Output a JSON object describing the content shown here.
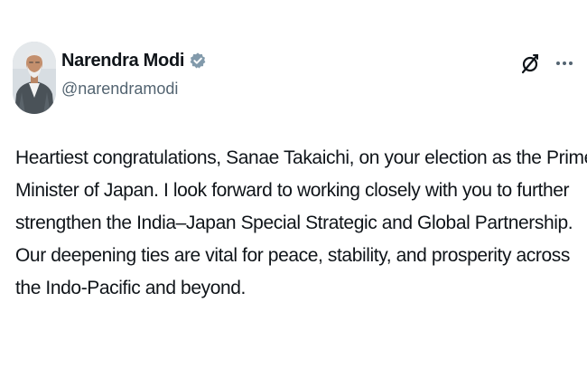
{
  "colors": {
    "text_primary": "#0f1419",
    "text_secondary": "#536471",
    "verified_badge": "#829aab",
    "background": "#ffffff"
  },
  "author": {
    "display_name": "Narendra Modi",
    "handle": "@narendramodi",
    "verified": true,
    "avatar_icon": "profile-photo"
  },
  "actions": {
    "grok_icon": "grok-icon",
    "more_icon": "more-icon"
  },
  "tweet": {
    "lines": [
      "Heartiest congratulations, Sanae Takaichi, on your election as the Prime",
      "Minister of Japan. I look forward to working closely with you to further",
      "strengthen the India–Japan Special Strategic and Global Partnership.",
      "Our deepening ties are vital for peace, stability, and prosperity across",
      "the Indo-Pacific and beyond."
    ]
  }
}
